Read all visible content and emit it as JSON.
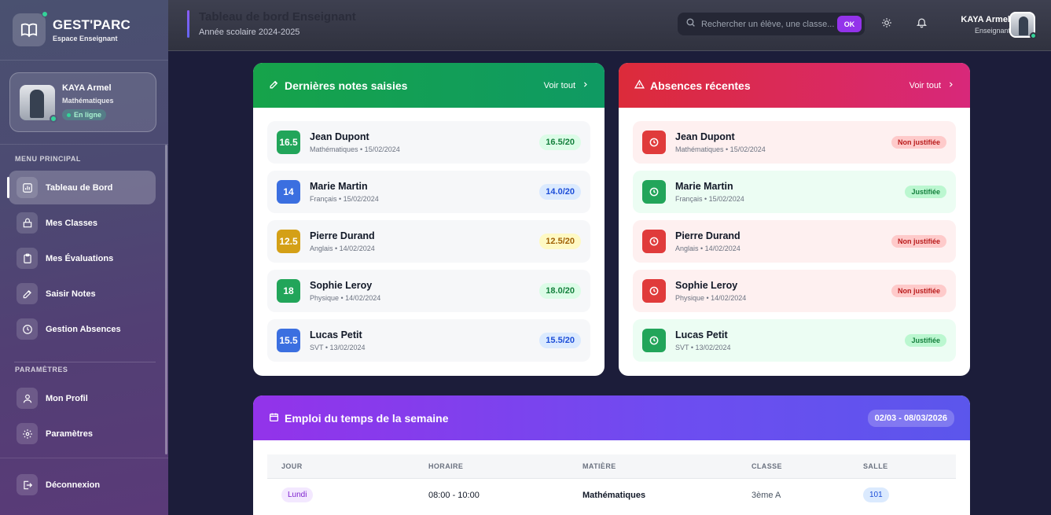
{
  "sidebar": {
    "brand_title": "GEST'PARC",
    "brand_sub": "Espace Enseignant",
    "user_name": "KAYA Armel",
    "user_subject": "Mathématiques",
    "user_status": "En ligne",
    "section_main": "MENU PRINCIPAL",
    "section_settings": "PARAMÈTRES",
    "items": [
      {
        "label": "Tableau de Bord",
        "icon": "chart-icon"
      },
      {
        "label": "Mes Classes",
        "icon": "classes-icon"
      },
      {
        "label": "Mes Évaluations",
        "icon": "clipboard-icon"
      },
      {
        "label": "Saisir Notes",
        "icon": "edit-icon"
      },
      {
        "label": "Gestion Absences",
        "icon": "clock-icon"
      },
      {
        "label": "Mon Profil",
        "icon": "user-icon"
      },
      {
        "label": "Paramètres",
        "icon": "gear-icon"
      },
      {
        "label": "Déconnexion",
        "icon": "logout-icon"
      }
    ]
  },
  "header": {
    "title": "Tableau de bord Enseignant",
    "subtitle": "Année scolaire 2024-2025",
    "search_placeholder": "Rechercher un élève, une classe...",
    "search_button": "OK",
    "user_name": "KAYA Armel",
    "user_role": "Enseignant"
  },
  "notes": {
    "title": "Dernières notes saisies",
    "voir_tout": "Voir tout",
    "rows": [
      {
        "grade": "16.5",
        "name": "Jean Dupont",
        "meta": "Mathématiques • 15/02/2024",
        "score": "16.5/20",
        "color": "#22a55a",
        "pill_bg": "#dcfce7",
        "pill_fg": "#15803d"
      },
      {
        "grade": "14",
        "name": "Marie Martin",
        "meta": "Français • 15/02/2024",
        "score": "14.0/20",
        "color": "#3b6fe0",
        "pill_bg": "#dbeafe",
        "pill_fg": "#1d4ed8"
      },
      {
        "grade": "12.5",
        "name": "Pierre Durand",
        "meta": "Anglais • 14/02/2024",
        "score": "12.5/20",
        "color": "#d4a017",
        "pill_bg": "#fef9c3",
        "pill_fg": "#a16207"
      },
      {
        "grade": "18",
        "name": "Sophie Leroy",
        "meta": "Physique • 14/02/2024",
        "score": "18.0/20",
        "color": "#22a55a",
        "pill_bg": "#dcfce7",
        "pill_fg": "#15803d"
      },
      {
        "grade": "15.5",
        "name": "Lucas Petit",
        "meta": "SVT • 13/02/2024",
        "score": "15.5/20",
        "color": "#3b6fe0",
        "pill_bg": "#dbeafe",
        "pill_fg": "#1d4ed8"
      }
    ]
  },
  "absences": {
    "title": "Absences récentes",
    "voir_tout": "Voir tout",
    "rows": [
      {
        "name": "Jean Dupont",
        "meta": "Mathématiques • 15/02/2024",
        "status": "Non justifiée",
        "justified": false
      },
      {
        "name": "Marie Martin",
        "meta": "Français • 15/02/2024",
        "status": "Justifiée",
        "justified": true
      },
      {
        "name": "Pierre Durand",
        "meta": "Anglais • 14/02/2024",
        "status": "Non justifiée",
        "justified": false
      },
      {
        "name": "Sophie Leroy",
        "meta": "Physique • 14/02/2024",
        "status": "Non justifiée",
        "justified": false
      },
      {
        "name": "Lucas Petit",
        "meta": "SVT • 13/02/2024",
        "status": "Justifiée",
        "justified": true
      }
    ]
  },
  "schedule": {
    "title": "Emploi du temps de la semaine",
    "week": "02/03 - 08/03/2026",
    "columns": [
      "JOUR",
      "HORAIRE",
      "MATIÈRE",
      "CLASSE",
      "SALLE"
    ],
    "rows": [
      {
        "jour": "Lundi",
        "horaire": "08:00 - 10:00",
        "matiere": "Mathématiques",
        "classe": "3ème A",
        "salle": "101"
      }
    ]
  }
}
